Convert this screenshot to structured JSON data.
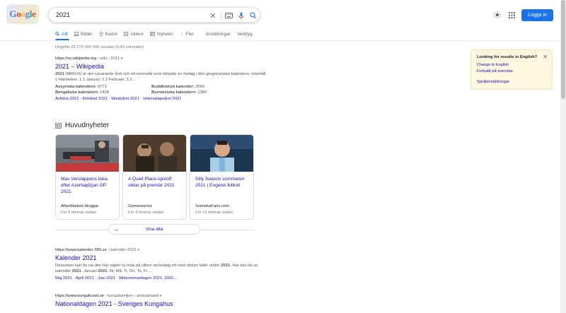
{
  "header": {
    "logo_text": "Google",
    "search_value": "2021",
    "login_label": "Logga in"
  },
  "tabs": [
    {
      "label": "Allt",
      "icon": "search-icon"
    },
    {
      "label": "Bilder",
      "icon": "image-icon"
    },
    {
      "label": "Kartor",
      "icon": "map-pin-icon"
    },
    {
      "label": "Videor",
      "icon": "video-icon"
    },
    {
      "label": "Nyheter",
      "icon": "newspaper-icon"
    },
    {
      "label": "Fler",
      "icon": "more-icon"
    },
    {
      "label": "Inställningar"
    },
    {
      "label": "Verktyg"
    }
  ],
  "stats": "Ungefär 25 270 000 000 resultat (0,43 sekunder)",
  "results": [
    {
      "url": "https://sv.wikipedia.org",
      "path": " › wiki › 2021",
      "title": "2021 – Wikipedia",
      "snippet_lead": "2021",
      "snippet": " (MMXXI) är det nuvarande året och ett normalår som började en fredag i den gregorianska kalendern. Innehåll. 1 Händelser. 1.1 Januari; 1.2 Februari; 1.3 ...",
      "facts": [
        {
          "label": "Assyriska kalendern:",
          "value": "6771"
        },
        {
          "label": "Buddhistisk kalender:",
          "value": "2565"
        },
        {
          "label": "Bengaliska kalendern:",
          "value": "1428"
        },
        {
          "label": "Burmesiska kalendern:",
          "value": "1383"
        }
      ],
      "sitelinks": [
        "Avlidna 2021",
        "Filmåret 2021",
        "Musikåret 2021",
        "Vetenskapsåret 2021"
      ]
    },
    {
      "url": "https://www.kalender-365.se",
      "path": " › kalender-2021",
      "title": "Kalender 2021",
      "snippet_a": "Dessutom kan du via den här sajten ta reda på vilken veckodag ett visst datum faller under ",
      "snippet_b": "2021",
      "snippet_c": ". Här kan du se kalender ",
      "snippet_d": "2021",
      "snippet_e": ". Januari ",
      "snippet_f": "2021",
      "snippet_g": ". Nr. Må, Ti, On, To, Fr ...",
      "sitelinks": [
        "Maj 2021",
        "April 2021",
        "Juni 2021",
        "Midsommardagen 2021, 2022..."
      ]
    },
    {
      "url": "https://www.kungahuset.se",
      "path": " › kungafamiljen › aretsaktuellt",
      "title": "Nationaldagen 2021 - Sveriges Kungahus"
    }
  ],
  "news": {
    "heading": "Huvudnyheter",
    "cards": [
      {
        "title": "Max Verstappens ilska efter Azerbajdzjan GP 2021",
        "source": "Aftonbladets bloggar",
        "time": "För 5 timmar sedan"
      },
      {
        "title": "A Quiet Place-spinoff siktar på premiär 2021",
        "source": "Gamereactor",
        "time": "För 3 timmar sedan"
      },
      {
        "title": "Silly Season sommaren 2021 | Engelsk fotboll",
        "source": "SvenskaFans.com",
        "time": "För 12 timmar sedan"
      }
    ],
    "view_all": "Visa alla"
  },
  "language_panel": {
    "question": "Looking for results in English?",
    "change": "Change to English",
    "continue": "Fortsätt på svenska",
    "settings": "Språkinställningar"
  },
  "colors": {
    "link": "#1a0dab",
    "accent": "#1a73e8",
    "panel_bg": "#fef7e0"
  }
}
